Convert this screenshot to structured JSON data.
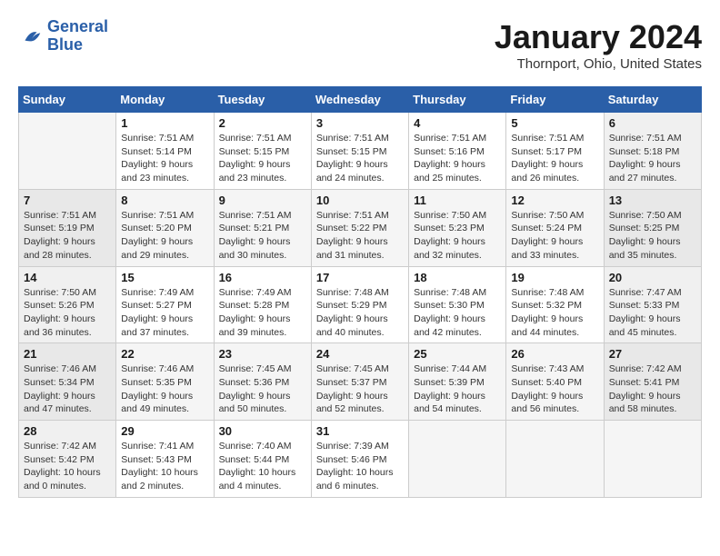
{
  "header": {
    "logo_general": "General",
    "logo_blue": "Blue",
    "month": "January 2024",
    "location": "Thornport, Ohio, United States"
  },
  "days_of_week": [
    "Sunday",
    "Monday",
    "Tuesday",
    "Wednesday",
    "Thursday",
    "Friday",
    "Saturday"
  ],
  "weeks": [
    [
      {
        "num": "",
        "info": ""
      },
      {
        "num": "1",
        "info": "Sunrise: 7:51 AM\nSunset: 5:14 PM\nDaylight: 9 hours\nand 23 minutes."
      },
      {
        "num": "2",
        "info": "Sunrise: 7:51 AM\nSunset: 5:15 PM\nDaylight: 9 hours\nand 23 minutes."
      },
      {
        "num": "3",
        "info": "Sunrise: 7:51 AM\nSunset: 5:15 PM\nDaylight: 9 hours\nand 24 minutes."
      },
      {
        "num": "4",
        "info": "Sunrise: 7:51 AM\nSunset: 5:16 PM\nDaylight: 9 hours\nand 25 minutes."
      },
      {
        "num": "5",
        "info": "Sunrise: 7:51 AM\nSunset: 5:17 PM\nDaylight: 9 hours\nand 26 minutes."
      },
      {
        "num": "6",
        "info": "Sunrise: 7:51 AM\nSunset: 5:18 PM\nDaylight: 9 hours\nand 27 minutes."
      }
    ],
    [
      {
        "num": "7",
        "info": "Sunrise: 7:51 AM\nSunset: 5:19 PM\nDaylight: 9 hours\nand 28 minutes."
      },
      {
        "num": "8",
        "info": "Sunrise: 7:51 AM\nSunset: 5:20 PM\nDaylight: 9 hours\nand 29 minutes."
      },
      {
        "num": "9",
        "info": "Sunrise: 7:51 AM\nSunset: 5:21 PM\nDaylight: 9 hours\nand 30 minutes."
      },
      {
        "num": "10",
        "info": "Sunrise: 7:51 AM\nSunset: 5:22 PM\nDaylight: 9 hours\nand 31 minutes."
      },
      {
        "num": "11",
        "info": "Sunrise: 7:50 AM\nSunset: 5:23 PM\nDaylight: 9 hours\nand 32 minutes."
      },
      {
        "num": "12",
        "info": "Sunrise: 7:50 AM\nSunset: 5:24 PM\nDaylight: 9 hours\nand 33 minutes."
      },
      {
        "num": "13",
        "info": "Sunrise: 7:50 AM\nSunset: 5:25 PM\nDaylight: 9 hours\nand 35 minutes."
      }
    ],
    [
      {
        "num": "14",
        "info": "Sunrise: 7:50 AM\nSunset: 5:26 PM\nDaylight: 9 hours\nand 36 minutes."
      },
      {
        "num": "15",
        "info": "Sunrise: 7:49 AM\nSunset: 5:27 PM\nDaylight: 9 hours\nand 37 minutes."
      },
      {
        "num": "16",
        "info": "Sunrise: 7:49 AM\nSunset: 5:28 PM\nDaylight: 9 hours\nand 39 minutes."
      },
      {
        "num": "17",
        "info": "Sunrise: 7:48 AM\nSunset: 5:29 PM\nDaylight: 9 hours\nand 40 minutes."
      },
      {
        "num": "18",
        "info": "Sunrise: 7:48 AM\nSunset: 5:30 PM\nDaylight: 9 hours\nand 42 minutes."
      },
      {
        "num": "19",
        "info": "Sunrise: 7:48 AM\nSunset: 5:32 PM\nDaylight: 9 hours\nand 44 minutes."
      },
      {
        "num": "20",
        "info": "Sunrise: 7:47 AM\nSunset: 5:33 PM\nDaylight: 9 hours\nand 45 minutes."
      }
    ],
    [
      {
        "num": "21",
        "info": "Sunrise: 7:46 AM\nSunset: 5:34 PM\nDaylight: 9 hours\nand 47 minutes."
      },
      {
        "num": "22",
        "info": "Sunrise: 7:46 AM\nSunset: 5:35 PM\nDaylight: 9 hours\nand 49 minutes."
      },
      {
        "num": "23",
        "info": "Sunrise: 7:45 AM\nSunset: 5:36 PM\nDaylight: 9 hours\nand 50 minutes."
      },
      {
        "num": "24",
        "info": "Sunrise: 7:45 AM\nSunset: 5:37 PM\nDaylight: 9 hours\nand 52 minutes."
      },
      {
        "num": "25",
        "info": "Sunrise: 7:44 AM\nSunset: 5:39 PM\nDaylight: 9 hours\nand 54 minutes."
      },
      {
        "num": "26",
        "info": "Sunrise: 7:43 AM\nSunset: 5:40 PM\nDaylight: 9 hours\nand 56 minutes."
      },
      {
        "num": "27",
        "info": "Sunrise: 7:42 AM\nSunset: 5:41 PM\nDaylight: 9 hours\nand 58 minutes."
      }
    ],
    [
      {
        "num": "28",
        "info": "Sunrise: 7:42 AM\nSunset: 5:42 PM\nDaylight: 10 hours\nand 0 minutes."
      },
      {
        "num": "29",
        "info": "Sunrise: 7:41 AM\nSunset: 5:43 PM\nDaylight: 10 hours\nand 2 minutes."
      },
      {
        "num": "30",
        "info": "Sunrise: 7:40 AM\nSunset: 5:44 PM\nDaylight: 10 hours\nand 4 minutes."
      },
      {
        "num": "31",
        "info": "Sunrise: 7:39 AM\nSunset: 5:46 PM\nDaylight: 10 hours\nand 6 minutes."
      },
      {
        "num": "",
        "info": ""
      },
      {
        "num": "",
        "info": ""
      },
      {
        "num": "",
        "info": ""
      }
    ]
  ]
}
